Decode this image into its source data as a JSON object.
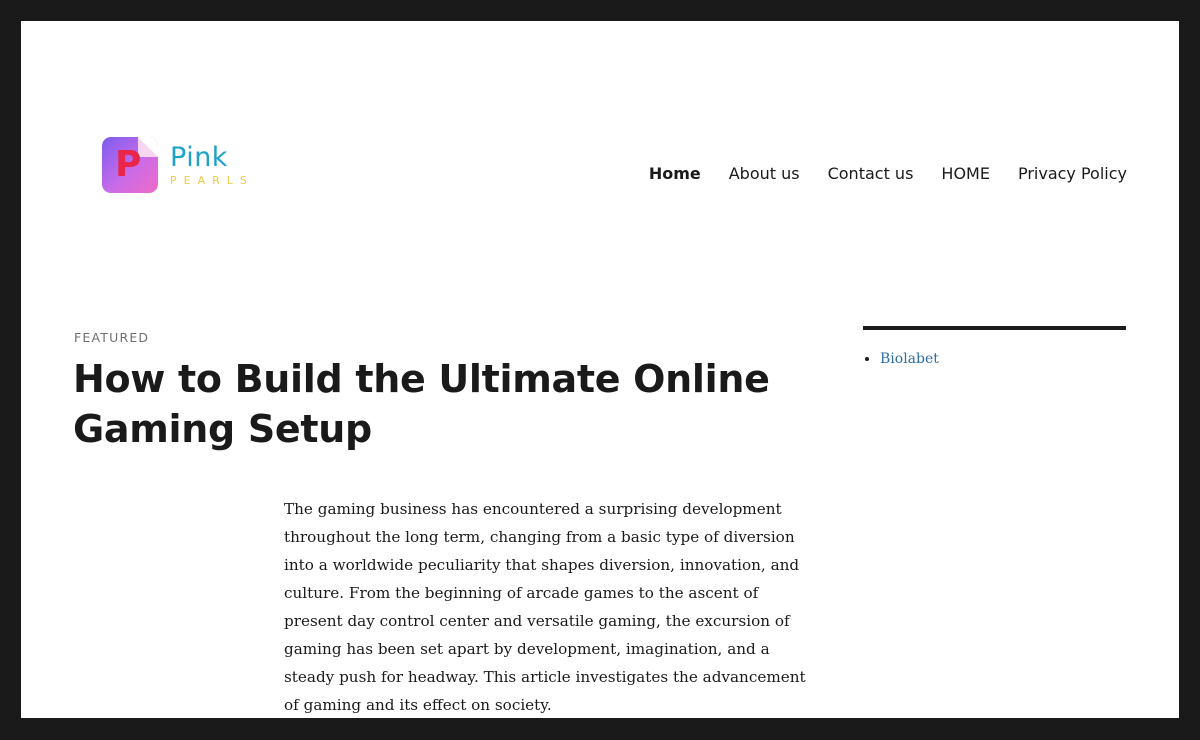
{
  "site": {
    "logo_word1": "Pink",
    "logo_word2": "PEARLS",
    "logo_letter": "P"
  },
  "nav": {
    "items": [
      {
        "label": "Home",
        "active": true
      },
      {
        "label": "About us",
        "active": false
      },
      {
        "label": "Contact us",
        "active": false
      },
      {
        "label": "HOME",
        "active": false
      },
      {
        "label": "Privacy Policy",
        "active": false
      }
    ]
  },
  "post": {
    "category": "FEATURED",
    "title": "How to Build the Ultimate Online Gaming Setup",
    "paragraph": "The gaming business has encountered a surprising development throughout the long term, changing from a basic type of diversion into a worldwide peculiarity that shapes diversion, innovation, and culture. From the beginning of arcade games to the ascent of present day control center and versatile gaming, the excursion of gaming has been set apart by development, imagination, and a steady push for headway. This article investigates the advancement of gaming and its effect on society."
  },
  "sidebar": {
    "links": [
      {
        "label": "Biolabet"
      }
    ]
  },
  "colors": {
    "frame": "#1a1a1a",
    "link": "#2c6fa8",
    "logo_blue": "#1fa2c9",
    "logo_yellow": "#f3c94a",
    "logo_red": "#e8264a"
  }
}
